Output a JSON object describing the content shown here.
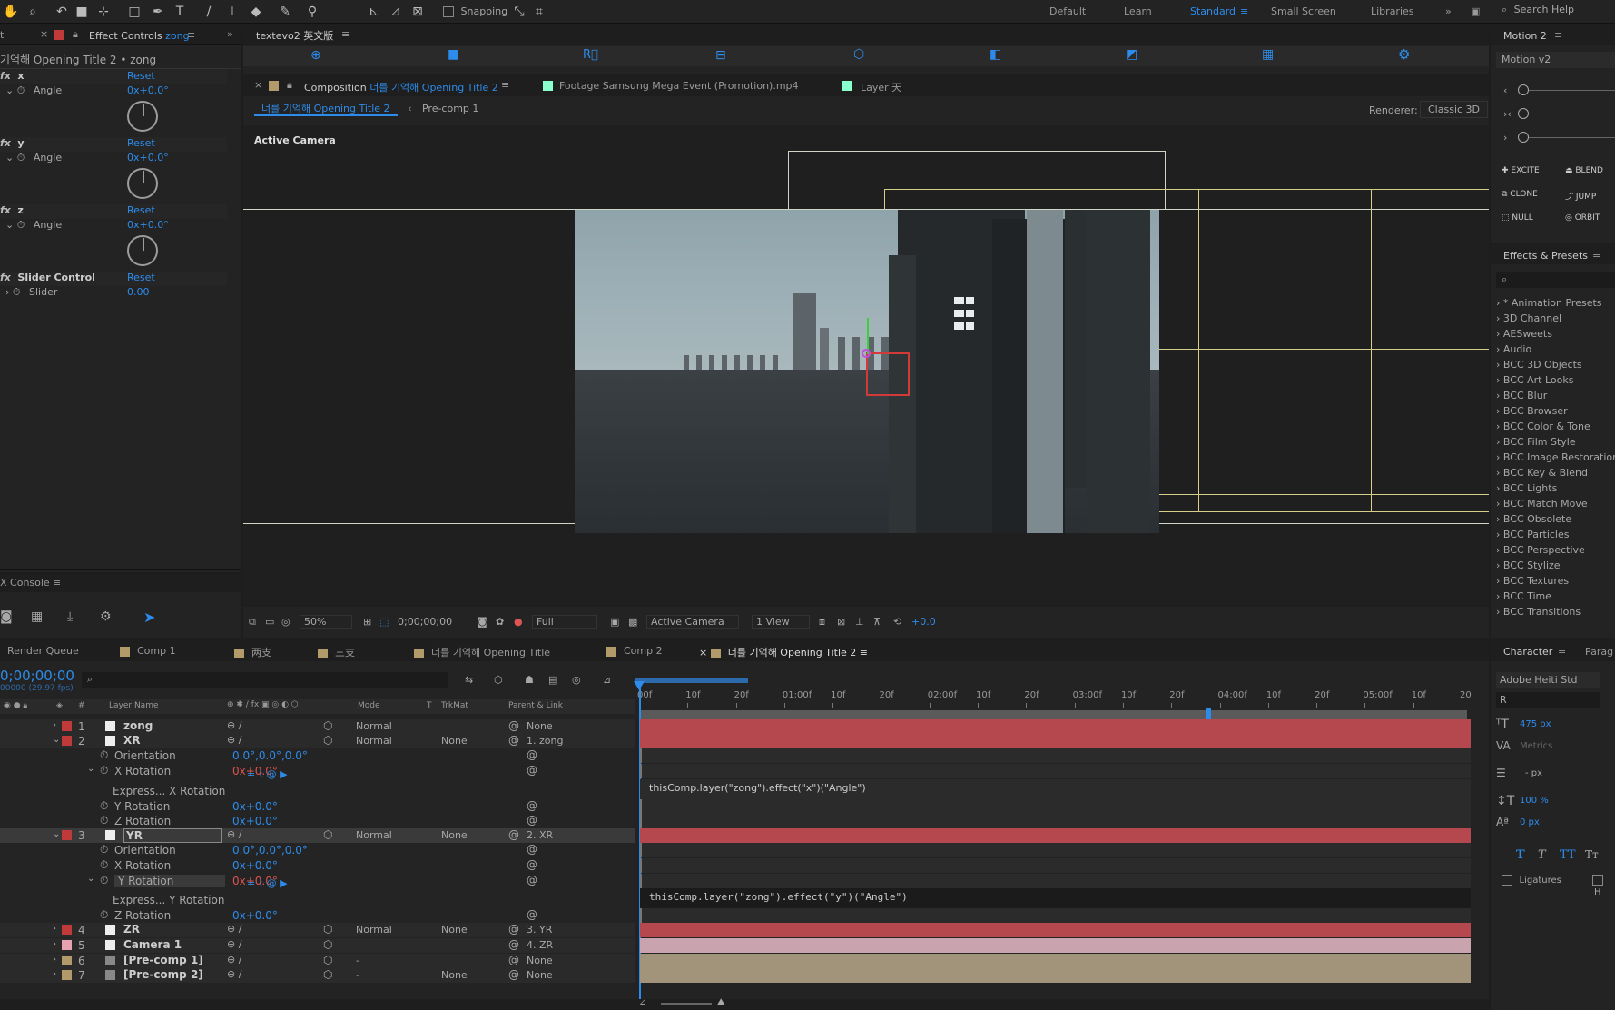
{
  "toolbar": {
    "snapping_label": "Snapping",
    "workspaces": [
      "Default",
      "Learn",
      "Standard",
      "Small Screen",
      "Libraries"
    ],
    "active_workspace": "Standard",
    "search_placeholder": "Search Help",
    "tools": [
      "hand-icon",
      "zoom-icon",
      "rotate-icon",
      "camera-icon",
      "pan-behind-icon",
      "rectangle-icon",
      "pen-icon",
      "type-icon",
      "brush-icon",
      "clone-stamp-icon",
      "eraser-icon",
      "roto-brush-icon",
      "puppet-pin-icon"
    ]
  },
  "effect_controls": {
    "tab_left": "t",
    "tab_label": "Effect Controls",
    "tab_layer": "zong",
    "title": "기억해 Opening Title 2 • zong",
    "effects": [
      {
        "fx": "fx",
        "name": "x",
        "reset": "Reset",
        "param": "Angle",
        "value": "0x+0.0°"
      },
      {
        "fx": "fx",
        "name": "y",
        "reset": "Reset",
        "param": "Angle",
        "value": "0x+0.0°"
      },
      {
        "fx": "fx",
        "name": "z",
        "reset": "Reset",
        "param": "Angle",
        "value": "0x+0.0°"
      },
      {
        "fx": "fx",
        "name": "Slider Control",
        "reset": "Reset",
        "param": "Slider",
        "value": "0.00"
      }
    ]
  },
  "console": {
    "title": "X Console"
  },
  "motion_tools_bar": {
    "tab_label": "textevo2 英文版"
  },
  "viewer": {
    "tabs": [
      {
        "prefix": "Composition",
        "name": "너를 기억해 Opening Title 2"
      },
      {
        "prefix": "Footage",
        "name": "Samsung Mega Event (Promotion).mp4"
      },
      {
        "prefix": "Layer",
        "name": "天"
      }
    ],
    "breadcrumbs": [
      "너를 기억해 Opening Title 2",
      "Pre-comp 1"
    ],
    "renderer_label": "Renderer:",
    "renderer_value": "Classic 3D",
    "camera_label": "Active Camera",
    "zoom": "50%",
    "timecode": "0;00;00;00",
    "resolution": "Full",
    "camera_select": "Active Camera",
    "view_select": "1 View",
    "exposure": "+0.0"
  },
  "motion_panel": {
    "title": "Motion 2",
    "version": "Motion v2",
    "buttons": [
      "EXCITE",
      "BLEND",
      "CLONE",
      "JUMP",
      "NULL",
      "ORBIT"
    ]
  },
  "effects_presets": {
    "title": "Effects & Presets",
    "items": [
      "* Animation Presets",
      "3D Channel",
      "AESweets",
      "Audio",
      "BCC 3D Objects",
      "BCC Art Looks",
      "BCC Blur",
      "BCC Browser",
      "BCC Color & Tone",
      "BCC Film Style",
      "BCC Image Restoration",
      "BCC Key & Blend",
      "BCC Lights",
      "BCC Match Move",
      "BCC Obsolete",
      "BCC Particles",
      "BCC Perspective",
      "BCC Stylize",
      "BCC Textures",
      "BCC Time",
      "BCC Transitions"
    ]
  },
  "timeline": {
    "tabs": [
      "Render Queue",
      "Comp 1",
      "两支",
      "三支",
      "너를 기억해 Opening Title",
      "Comp 2",
      "너를 기억해 Opening Title 2"
    ],
    "active_tab": "너를 기억해 Opening Title 2",
    "timecode": "0;00;00;00",
    "fps": "00000 (29.97 fps)",
    "headers": {
      "num": "#",
      "layer_name": "Layer Name",
      "mode": "Mode",
      "t": "T",
      "trkmat": "TrkMat",
      "parent": "Parent & Link"
    },
    "ruler": [
      "00f",
      "10f",
      "20f",
      "01:00f",
      "10f",
      "20f",
      "02:00f",
      "10f",
      "20f",
      "03:00f",
      "10f",
      "20f",
      "04:00f",
      "10f",
      "20f",
      "05:00f",
      "10f",
      "20"
    ],
    "rows": [
      {
        "kind": "layer",
        "num": "1",
        "name": "zong",
        "color": "#c03a3a",
        "mode": "Normal",
        "trkmat": "",
        "parent": "None"
      },
      {
        "kind": "layer",
        "num": "2",
        "name": "XR",
        "color": "#c03a3a",
        "mode": "Normal",
        "trkmat": "None",
        "parent": "1. zong"
      },
      {
        "kind": "prop",
        "name": "Orientation",
        "value": "0.0°,0.0°,0.0°"
      },
      {
        "kind": "prop",
        "name": "X Rotation",
        "value": "0x+0.0°"
      },
      {
        "kind": "expr",
        "name": "Express... X Rotation",
        "code": "thisComp.layer(\"zong\").effect(\"x\")(\"Angle\")"
      },
      {
        "kind": "prop",
        "name": "Y Rotation",
        "value": "0x+0.0°"
      },
      {
        "kind": "prop",
        "name": "Z Rotation",
        "value": "0x+0.0°"
      },
      {
        "kind": "layer",
        "num": "3",
        "name": "YR",
        "color": "#c03a3a",
        "mode": "Normal",
        "trkmat": "None",
        "parent": "2. XR"
      },
      {
        "kind": "prop",
        "name": "Orientation",
        "value": "0.0°,0.0°,0.0°"
      },
      {
        "kind": "prop",
        "name": "X Rotation",
        "value": "0x+0.0°"
      },
      {
        "kind": "prop",
        "name": "Y Rotation",
        "value": "0x+0.0°"
      },
      {
        "kind": "expr",
        "name": "Express... Y Rotation",
        "code": "thisComp.layer(\"zong\").effect(\"y\")(\"Angle\")"
      },
      {
        "kind": "prop",
        "name": "Z Rotation",
        "value": "0x+0.0°"
      },
      {
        "kind": "layer",
        "num": "4",
        "name": "ZR",
        "color": "#c03a3a",
        "mode": "Normal",
        "trkmat": "None",
        "parent": "3. YR"
      },
      {
        "kind": "layer",
        "num": "5",
        "name": "Camera 1",
        "color": "#e8a3b0",
        "mode": "",
        "trkmat": "",
        "parent": "4. ZR"
      },
      {
        "kind": "layer",
        "num": "6",
        "name": "[Pre-comp 1]",
        "color": "#b39a6b",
        "mode": "-",
        "trkmat": "",
        "parent": "None"
      },
      {
        "kind": "layer",
        "num": "7",
        "name": "[Pre-comp 2]",
        "color": "#b39a6b",
        "mode": "-",
        "trkmat": "None",
        "parent": "None"
      }
    ]
  },
  "character": {
    "title": "Character",
    "tab2": "Parag",
    "font": "Adobe Heiti Std",
    "style": "R",
    "size": "475 px",
    "kerning": "Metrics",
    "leading": "- px",
    "vscale": "100 %",
    "baseline": "0 px",
    "ligatures_label": "Ligatures",
    "hindi_label": "H"
  }
}
